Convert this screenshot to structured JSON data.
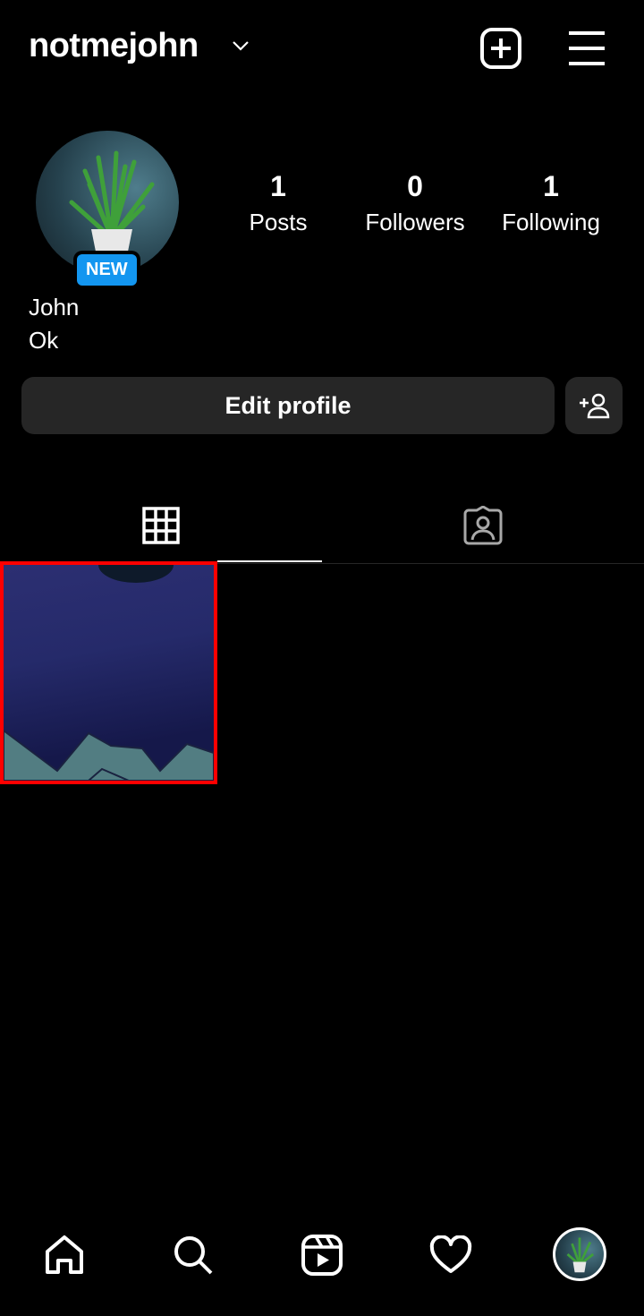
{
  "header": {
    "username": "notmejohn",
    "icons": [
      "chevron-down-icon",
      "new-post-icon",
      "menu-icon"
    ]
  },
  "profile": {
    "badge": "NEW",
    "name": "John",
    "bio": "Ok",
    "stats": [
      {
        "value": "1",
        "label": "Posts"
      },
      {
        "value": "0",
        "label": "Followers"
      },
      {
        "value": "1",
        "label": "Following"
      }
    ],
    "edit_label": "Edit profile"
  },
  "tabs": [
    "grid-icon",
    "tagged-icon"
  ],
  "colors": {
    "badge": "#1396f0",
    "button": "#262626",
    "highlight": "#ff0000"
  },
  "bottom_nav": [
    "home-icon",
    "search-icon",
    "reels-icon",
    "heart-icon",
    "profile-avatar"
  ]
}
